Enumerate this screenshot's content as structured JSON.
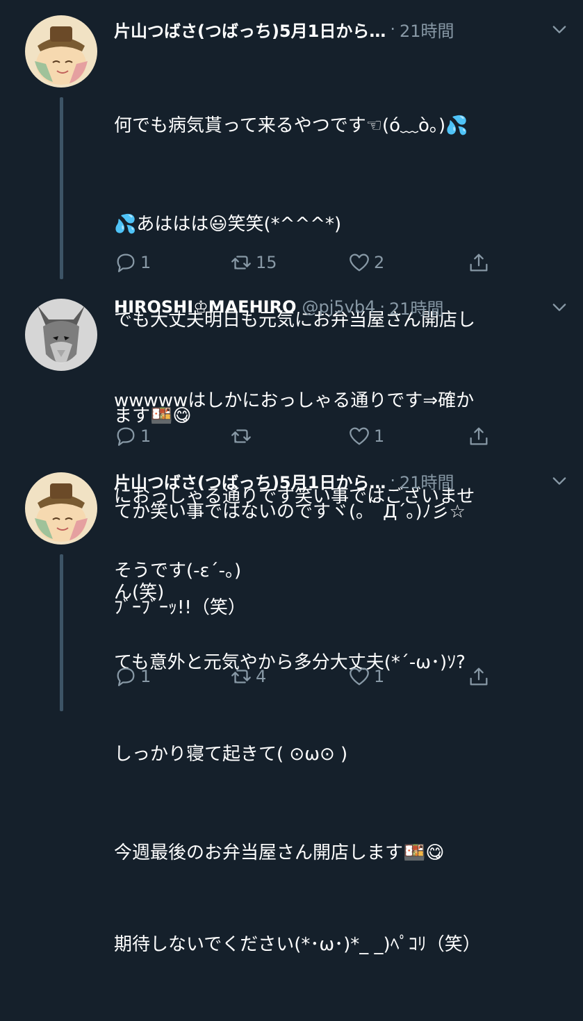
{
  "tweets": [
    {
      "name": "片山つばさ(つばっち)5月1日から…",
      "handle": "",
      "time": "21時間",
      "lines": [
        "何でも病気貰って来るやつです☜(ó﹏ò｡)💦",
        "💦あははは😃笑笑(*^^^*)",
        "でも大丈夫明日も元気にお弁当屋さん開店し",
        "ます🍱😋",
        "てか笑い事ではないのですヾ(｡｀Д´｡)ﾉ彡☆",
        "ﾌﾞｰﾌﾞｰｯ!!（笑）"
      ],
      "reply_count": "1",
      "retweet_count": "15",
      "like_count": "2"
    },
    {
      "name": "HIROSHI♔MAEHIRO",
      "handle": "@pj5vb4",
      "time": "21時間",
      "lines": [
        "wwwwwはしかにおっしゃる通りです⇒確か",
        "におっしゃる通りです笑い事ではございませ",
        "ん(笑)"
      ],
      "reply_count": "1",
      "retweet_count": "",
      "like_count": "1"
    },
    {
      "name": "片山つばさ(つばっち)5月1日から…",
      "handle": "",
      "time": "21時間",
      "lines": [
        "そうです(-ε´-。)",
        "ても意外と元気やから多分大丈夫(*´-ω･)ｿ?",
        "しっかり寝て起きて( ⊙ω⊙ )",
        "今週最後のお弁当屋さん開店します🍱😋",
        "期待しないでください(*･ω･)*_ _)ﾍﾟｺﾘ（笑）"
      ],
      "reply_count": "1",
      "retweet_count": "4",
      "like_count": "1"
    }
  ]
}
